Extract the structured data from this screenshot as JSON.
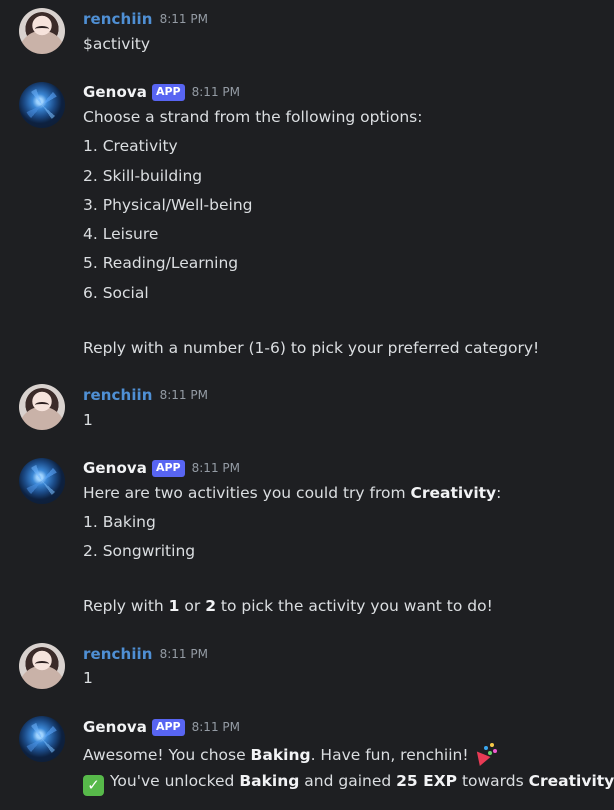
{
  "messages": [
    {
      "author": "renchiin",
      "time": "8:11 PM",
      "lines": [
        "$activity"
      ]
    },
    {
      "author": "Genova",
      "badge": "APP",
      "time": "8:11 PM",
      "lines": [
        "Choose a strand from the following options:",
        "1. Creativity",
        "2. Skill-building",
        "3. Physical/Well-being",
        "4. Leisure",
        "5. Reading/Learning",
        "6. Social",
        "Reply with a number (1-6) to pick your preferred category!"
      ]
    },
    {
      "author": "renchiin",
      "time": "8:11 PM",
      "lines": [
        "1"
      ]
    },
    {
      "author": "Genova",
      "badge": "APP",
      "time": "8:11 PM",
      "intro_prefix": "Here are two activities you could try from ",
      "intro_bold": "Creativity",
      "intro_suffix": ":",
      "lines": [
        "1. Baking",
        "2. Songwriting"
      ],
      "reply_parts": [
        "Reply with ",
        "1",
        " or ",
        "2",
        " to pick the activity you want to do!"
      ]
    },
    {
      "author": "renchiin",
      "time": "8:11 PM",
      "lines": [
        "1"
      ]
    },
    {
      "author": "Genova",
      "badge": "APP",
      "time": "8:11 PM",
      "line1_parts": [
        "Awesome! You chose ",
        "Baking",
        ". Have fun, renchiin!"
      ],
      "line1_emoji": "party-popper-icon",
      "line2_emoji": "check-mark-button-icon",
      "line2_parts": [
        "You've unlocked ",
        "Baking",
        " and gained ",
        "25 EXP",
        " towards ",
        "Creativity",
        "!"
      ]
    }
  ],
  "colors": {
    "background": "#1e1f22",
    "user_name": "#4f8fd4",
    "app_badge": "#5865f2",
    "timestamp": "#949ba4"
  }
}
